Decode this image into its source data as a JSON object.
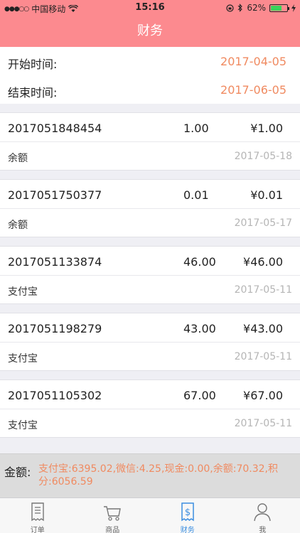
{
  "status": {
    "carrier": "中国移动",
    "time": "15:16",
    "battery_text": "62%",
    "battery_level": 0.62
  },
  "nav": {
    "title": "财务"
  },
  "filters": {
    "start_label": "开始时间:",
    "start_value": "2017-04-05",
    "end_label": "结束时间:",
    "end_value": "2017-06-05"
  },
  "records": [
    {
      "order_no": "2017051848454",
      "qty": "1.00",
      "amount": "¥1.00",
      "method": "余额",
      "date": "2017-05-18"
    },
    {
      "order_no": "2017051750377",
      "qty": "0.01",
      "amount": "¥0.01",
      "method": "余额",
      "date": "2017-05-17"
    },
    {
      "order_no": "2017051133874",
      "qty": "46.00",
      "amount": "¥46.00",
      "method": "支付宝",
      "date": "2017-05-11"
    },
    {
      "order_no": "2017051198279",
      "qty": "43.00",
      "amount": "¥43.00",
      "method": "支付宝",
      "date": "2017-05-11"
    },
    {
      "order_no": "2017051105302",
      "qty": "67.00",
      "amount": "¥67.00",
      "method": "支付宝",
      "date": "2017-05-11"
    }
  ],
  "summary": {
    "label": "金额:",
    "text": "支付宝:6395.02,微信:4.25,现金:0.00,余额:70.32,积分:6056.59"
  },
  "tabs": [
    {
      "label": "订单",
      "icon": "receipt-icon"
    },
    {
      "label": "商品",
      "icon": "cart-icon"
    },
    {
      "label": "财务",
      "icon": "finance-icon",
      "active": true
    },
    {
      "label": "我",
      "icon": "user-icon"
    }
  ],
  "colors": {
    "accent": "#fc8a8f",
    "highlight": "#f08a60",
    "active_tab": "#3b8ee0"
  }
}
